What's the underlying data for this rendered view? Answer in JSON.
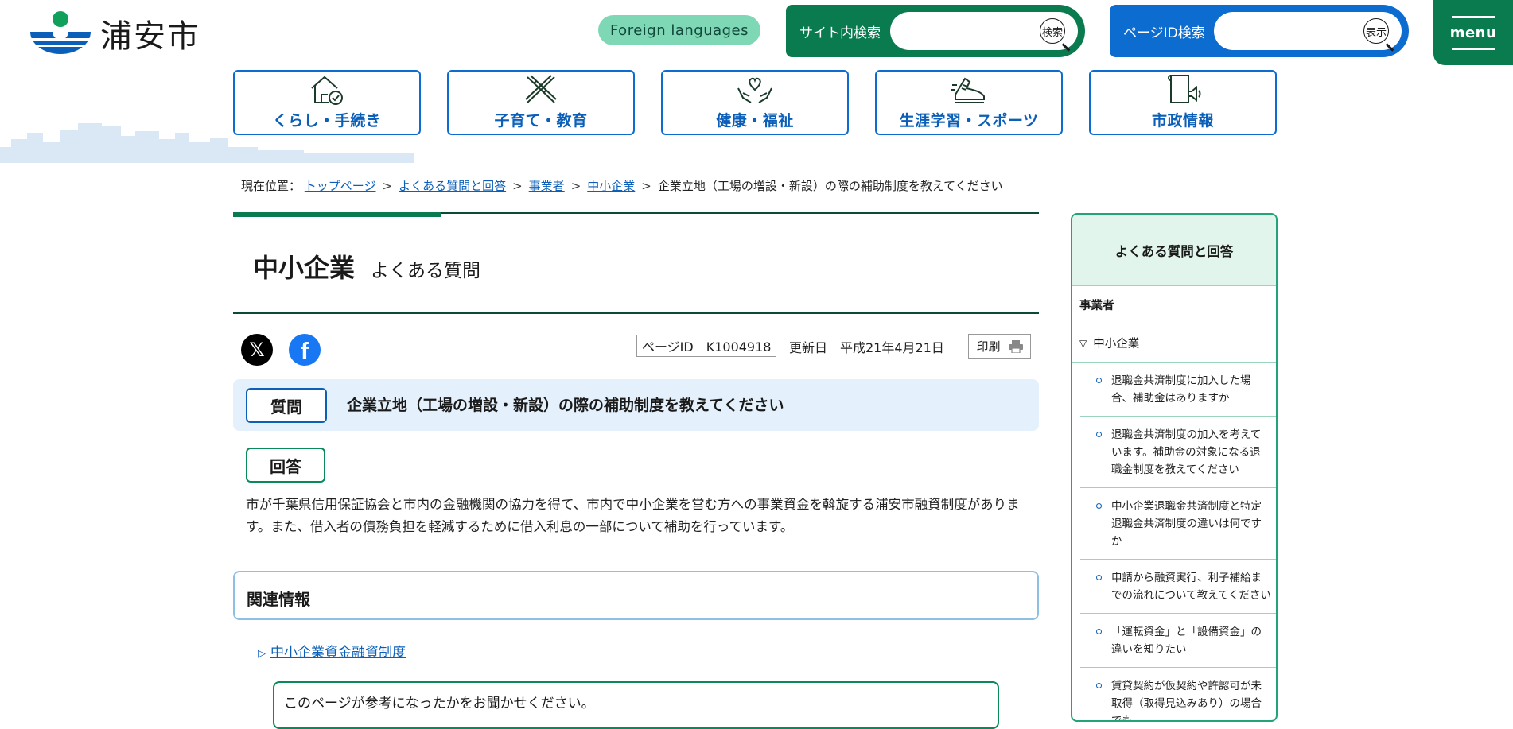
{
  "header": {
    "logo_text": "浦安市",
    "foreign_label": "Foreign languages",
    "site_search_label": "サイト内検索",
    "site_search_button": "検索",
    "page_id_search_label": "ページID検索",
    "page_id_search_button": "表示",
    "menu_label": "menu"
  },
  "nav": {
    "items": [
      {
        "label": "くらし・手続き",
        "icon": "house-check-icon"
      },
      {
        "label": "子育て・教育",
        "icon": "ruler-pencil-icon"
      },
      {
        "label": "健康・福祉",
        "icon": "heart-hands-icon"
      },
      {
        "label": "生涯学習・スポーツ",
        "icon": "shoe-icon"
      },
      {
        "label": "市政情報",
        "icon": "document-speaker-icon"
      }
    ]
  },
  "breadcrumb": {
    "prefix": "現在位置：",
    "links": [
      "トップページ",
      "よくある質問と回答",
      "事業者",
      "中小企業"
    ],
    "current": "企業立地（工場の増設・新設）の際の補助制度を教えてください",
    "separator": ">"
  },
  "main": {
    "title": "中小企業",
    "subtitle": "よくある質問",
    "page_id": "ページID　K1004918",
    "updated": "更新日　平成21年4月21日",
    "print_label": "印刷",
    "question_badge": "質問",
    "question_text": "企業立地（工場の増設・新設）の際の補助制度を教えてください",
    "answer_badge": "回答",
    "answer_text": "市が千葉県信用保証協会と市内の金融機関の協力を得て、市内で中小企業を営む方への事業資金を斡旋する浦安市融資制度があります。また、借入者の債務負担を軽減するために借入利息の一部について補助を行っています。",
    "related_title": "関連情報",
    "related_link": "中小企業資金融資制度",
    "feedback_text": "このページが参考になったかをお聞かせください。"
  },
  "sidebar": {
    "heading": "よくある質問と回答",
    "category": "事業者",
    "subcategory": "中小企業",
    "items": [
      "退職金共済制度に加入した場合、補助金はありますか",
      "退職金共済制度の加入を考えています。補助金の対象になる退職金制度を教えてください",
      "中小企業退職金共済制度と特定退職金共済制度の違いは何ですか",
      "申請から融資実行、利子補給までの流れについて教えてください",
      "「運転資金」と「設備資金」の違いを知りたい",
      "賃貸契約が仮契約や許認可が未取得（取得見込みあり）の場合でも"
    ]
  },
  "colors": {
    "brand_green": "#0a7a4f",
    "brand_blue": "#0d6ccf",
    "foreign_mint": "#7fd8b5",
    "question_bg": "#e4f0fb",
    "sidebar_head_bg": "#e1f5ec"
  }
}
